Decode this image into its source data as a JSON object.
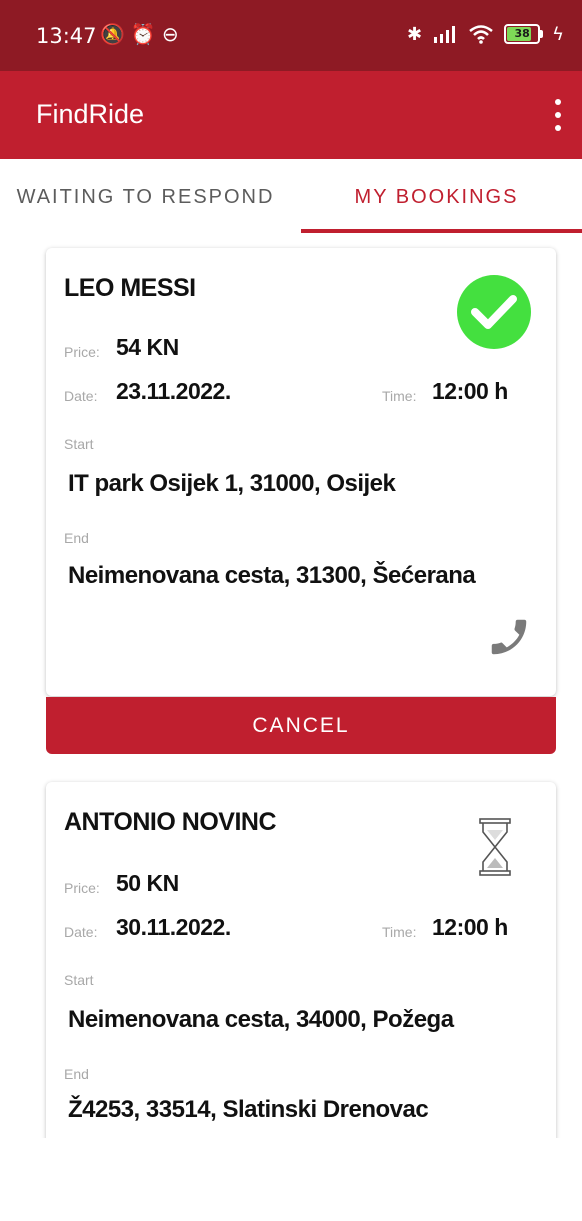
{
  "status_bar": {
    "time": "13:47",
    "battery": "38",
    "icons": [
      "mute-notification-icon",
      "alarm-icon",
      "vpn-icon",
      "bluetooth-icon",
      "signal-icon",
      "wifi-icon",
      "battery-icon",
      "charging-icon"
    ]
  },
  "app_bar": {
    "title": "FindRide",
    "menu_icon": "more-vertical-icon"
  },
  "tabs": [
    {
      "label": "WAITING TO RESPOND",
      "selected": false
    },
    {
      "label": "MY BOOKINGS",
      "selected": true
    }
  ],
  "bookings": [
    {
      "name": "LEO MESSI",
      "status_icon": "check-circle-icon",
      "price_label": "Price:",
      "price": "54 KN",
      "date_label": "Date:",
      "date": "23.11.2022.",
      "time_label": "Time:",
      "time": "12:00 h",
      "start_label": "Start",
      "start": "IT park Osijek 1, 31000, Osijek",
      "end_label": "End",
      "end": "Neimenovana cesta, 31300, Šećerana",
      "action_icon": "phone-icon",
      "cancel_label": "CANCEL"
    },
    {
      "name": "ANTONIO  NOVINC",
      "status_icon": "hourglass-icon",
      "price_label": "Price:",
      "price": "50 KN",
      "date_label": "Date:",
      "date": "30.11.2022.",
      "time_label": "Time:",
      "time": "12:00 h",
      "start_label": "Start",
      "start": "Neimenovana cesta, 34000, Požega",
      "end_label": "End",
      "end": "Ž4253, 33514, Slatinski Drenovac"
    }
  ],
  "colors": {
    "status_bar": "#8e1a24",
    "primary": "#c01f2f",
    "success": "#44e03f",
    "muted_label": "#a8a8a8"
  }
}
